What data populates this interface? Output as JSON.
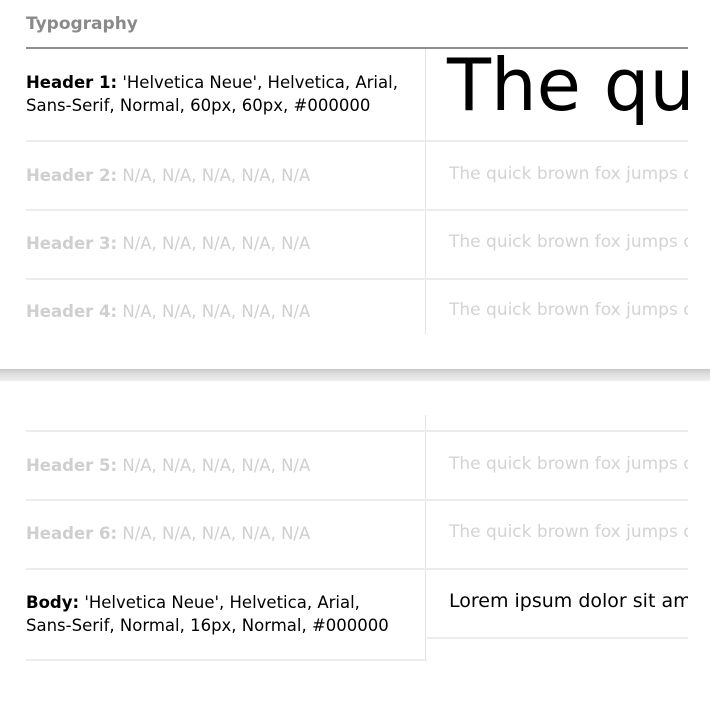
{
  "section": {
    "title": "Typography"
  },
  "rows": [
    {
      "name": "Header 1:",
      "spec": " 'Helvetica Neue', Helvetica, Arial,",
      "spec2": "Sans-Serif, Normal, 60px, 60px, #000000",
      "sample": "The quick brown fox jumps over the lazy dog"
    },
    {
      "name": "Header 2:",
      "spec": " N/A, N/A, N/A, N/A, N/A",
      "sample": "The quick brown fox jumps over the lazy dog"
    },
    {
      "name": "Header 3:",
      "spec": " N/A, N/A, N/A, N/A, N/A",
      "sample": "The quick brown fox jumps over the lazy dog"
    },
    {
      "name": "Header 4:",
      "spec": " N/A, N/A, N/A, N/A, N/A",
      "sample": "The quick brown fox jumps over the lazy dog"
    },
    {
      "name": "Header 5:",
      "spec": " N/A, N/A, N/A, N/A, N/A",
      "sample": "The quick brown fox jumps over the lazy dog"
    },
    {
      "name": "Header 6:",
      "spec": " N/A, N/A, N/A, N/A, N/A",
      "sample": "The quick brown fox jumps over the lazy dog"
    },
    {
      "name": "Body:",
      "spec": " 'Helvetica Neue', Helvetica, Arial,",
      "spec2": "Sans-Serif, Normal, 16px, Normal, #000000",
      "sample": "Lorem ipsum dolor sit amet, consectetur adipiscing elit"
    }
  ]
}
